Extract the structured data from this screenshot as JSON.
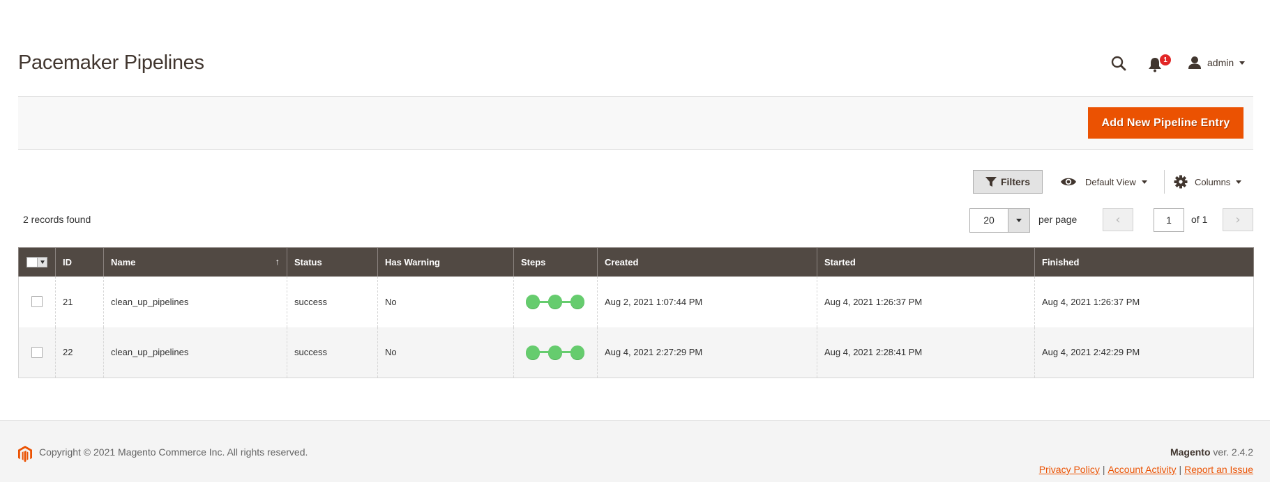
{
  "page": {
    "title": "Pacemaker Pipelines"
  },
  "header": {
    "notifications_count": "1",
    "user_name": "admin"
  },
  "page_actions": {
    "add_button_label": "Add New Pipeline Entry"
  },
  "toolbar": {
    "filters_label": "Filters",
    "view_label": "Default View",
    "columns_label": "Columns",
    "records_found": "2 records found",
    "per_page_value": "20",
    "per_page_label": "per page",
    "current_page": "1",
    "page_total_label": "of 1",
    "prev_glyph": "‹",
    "next_glyph": "›"
  },
  "grid": {
    "columns": [
      {
        "label": ""
      },
      {
        "label": "ID"
      },
      {
        "label": "Name",
        "sort": "↑"
      },
      {
        "label": "Status"
      },
      {
        "label": "Has Warning"
      },
      {
        "label": "Steps"
      },
      {
        "label": "Created"
      },
      {
        "label": "Started"
      },
      {
        "label": "Finished"
      }
    ],
    "rows": [
      {
        "id": "21",
        "name": "clean_up_pipelines",
        "status": "success",
        "has_warning": "No",
        "steps": [
          "success",
          "success",
          "success"
        ],
        "created": "Aug 2, 2021 1:07:44 PM",
        "started": "Aug 4, 2021 1:26:37 PM",
        "finished": "Aug 4, 2021 1:26:37 PM"
      },
      {
        "id": "22",
        "name": "clean_up_pipelines",
        "status": "success",
        "has_warning": "No",
        "steps": [
          "success",
          "success",
          "success"
        ],
        "created": "Aug 4, 2021 2:27:29 PM",
        "started": "Aug 4, 2021 2:28:41 PM",
        "finished": "Aug 4, 2021 2:42:29 PM"
      }
    ]
  },
  "footer": {
    "copyright": "Copyright © 2021 Magento Commerce Inc. All rights reserved.",
    "brand": "Magento",
    "version": " ver. 2.4.2",
    "links": {
      "privacy": "Privacy Policy",
      "activity": "Account Activity",
      "report": "Report an Issue"
    },
    "separator": "|"
  },
  "colors": {
    "accent": "#eb5202",
    "grid_header": "#514943",
    "step_success": "#66cc6e",
    "badge": "#e22626"
  }
}
